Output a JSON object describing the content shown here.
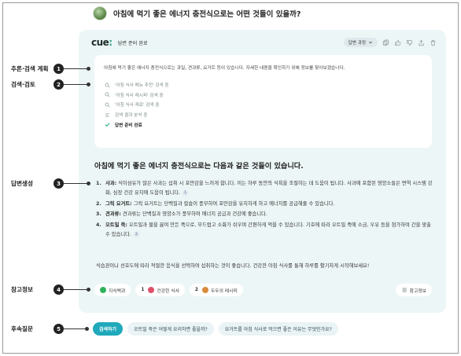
{
  "question": {
    "text": "아침에 먹기 좋은 에너지 충전식으로는 어떤 것들이 있을까?"
  },
  "header": {
    "logo_main": "cue",
    "logo_dot": ":",
    "status": "답변 준비 완료",
    "process_label": "답변 과정",
    "icons": [
      "copy-icon",
      "thumbs-up-icon",
      "thumbs-down-icon",
      "share-icon",
      "delete-icon"
    ]
  },
  "plan": {
    "text": "아침에 먹기 좋은 에너지 충전식으로는 과일, 견과류, 요거트 등이 있습니다. 자세한 내용을 확인하기 위해 정보를 찾아보겠습니다.",
    "steps": [
      {
        "icon": "search-icon",
        "label": "'아침 식사 메뉴 추천' 검색 중"
      },
      {
        "icon": "search-icon",
        "label": "'아침 식사 레시피' 검색 중"
      },
      {
        "icon": "search-icon",
        "label": "'아침 식사 재료' 검색 중"
      },
      {
        "icon": "list-icon",
        "label": "검색 결과 분석 중"
      },
      {
        "icon": "check-icon",
        "label": "답변 준비 완료"
      }
    ]
  },
  "answer": {
    "title": "아침에 먹기 좋은 에너지 충전식으로는 다음과 같은 것들이 있습니다.",
    "items": [
      {
        "num": "1.",
        "name": "사과:",
        "text": "식이섬유가 많은 사과는 섭취 시 포만감을 느끼게 합니다. 이는 하루 동안의 식욕을 조절하는 데 도움이 됩니다. 사과에 포함된 영양소들은 면역 시스템 강화, 심장 건강 유지에 도움이 됩니다.",
        "ref": "1"
      },
      {
        "num": "2.",
        "name": "그릭 요거트:",
        "text": "그릭 요거트는 단백질과 칼슘이 풍부하여 포만감을 유지하게 하고 에너지를 공급해줄 수 있습니다.",
        "ref": ""
      },
      {
        "num": "3.",
        "name": "견과류:",
        "text": "견과류는 단백질과 영양소가 풍부하여 에너지 공급과 건강에 좋습니다.",
        "ref": ""
      },
      {
        "num": "4.",
        "name": "오트밀 죽:",
        "text": "오트밀과 물을 끓여 만든 죽으로, 부드럽고 소화가 쉬우며 간편하게 먹을 수 있습니다. 기호에 따라 오트밀 죽에 소금, 우유 등을 첨가하여 간을 맞출 수 있습니다.",
        "ref": "2"
      }
    ],
    "summary": "식습관이나 선호도에 따라 적절한 음식을 선택하여 섭취하는 것이 좋습니다. 건강한 아침 식사를 통해 하루를 활기차게 시작해보세요!"
  },
  "references": {
    "chips": [
      {
        "num": "",
        "label": "지식백과",
        "color": "#2fb35a"
      },
      {
        "num": "1",
        "label": "건강한 식사",
        "color": "#e0506a"
      },
      {
        "num": "2",
        "label": "두두의 레시피",
        "color": "#d98a3a"
      }
    ],
    "more_label": "참고정보"
  },
  "followups": {
    "primary": "검색하기",
    "suggestions": [
      "오트밀 죽은 어떻게 요리하면 좋을까?",
      "요거트를 아침 식사로 먹으면 좋은 이유는 무엇인가요?"
    ]
  },
  "annotations": [
    {
      "num": "1",
      "label": "추론·검색 계획"
    },
    {
      "num": "2",
      "label": "검색·검토"
    },
    {
      "num": "3",
      "label": "답변생성"
    },
    {
      "num": "4",
      "label": "참고정보"
    },
    {
      "num": "5",
      "label": "후속질문"
    }
  ],
  "colors": {
    "accent": "#1fa9bb",
    "card_bg": "#edf6f6",
    "check": "#1aa97a"
  }
}
